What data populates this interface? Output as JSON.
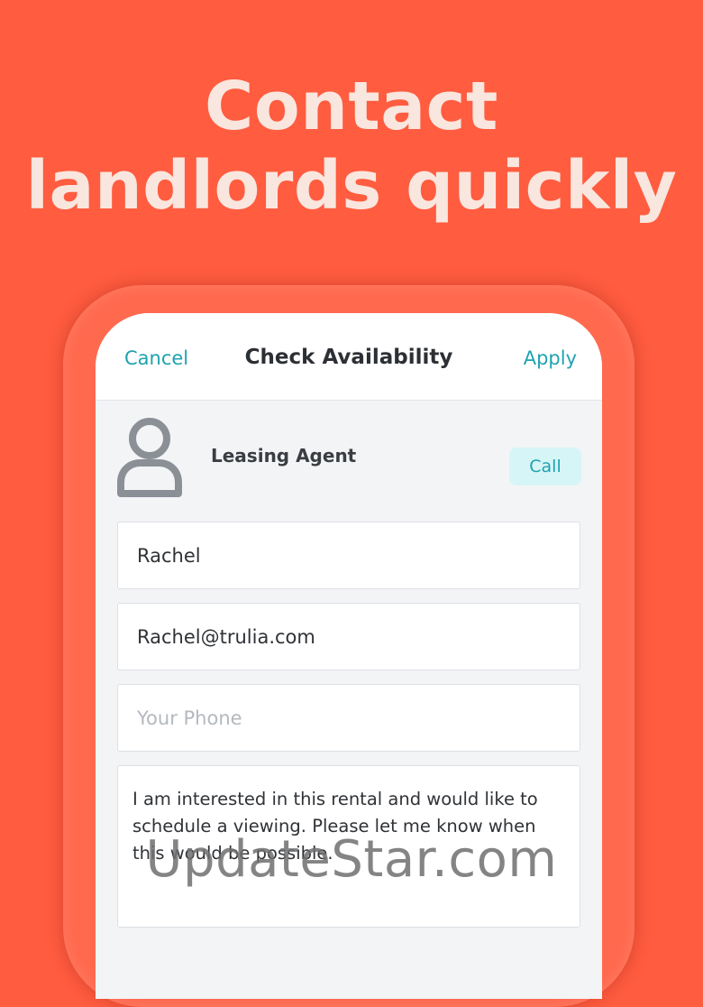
{
  "headline": {
    "line1": "Contact",
    "line2": "landlords quickly"
  },
  "colors": {
    "background": "#FF5C40",
    "headline": "#F9E6DE",
    "accent": "#1FA3B0",
    "call_button_bg": "#D6F5F6"
  },
  "nav": {
    "cancel_label": "Cancel",
    "title": "Check Availability",
    "apply_label": "Apply"
  },
  "agent": {
    "avatar_icon": "person-icon",
    "name": "Leasing Agent",
    "call_label": "Call"
  },
  "form": {
    "name_value": "Rachel",
    "email_value": "Rachel@trulia.com",
    "phone_placeholder": "Your Phone",
    "message_value": "I am interested in this rental and would like to schedule a viewing. Please let me know when this would be possible."
  },
  "watermark": "UpdateStar.com"
}
